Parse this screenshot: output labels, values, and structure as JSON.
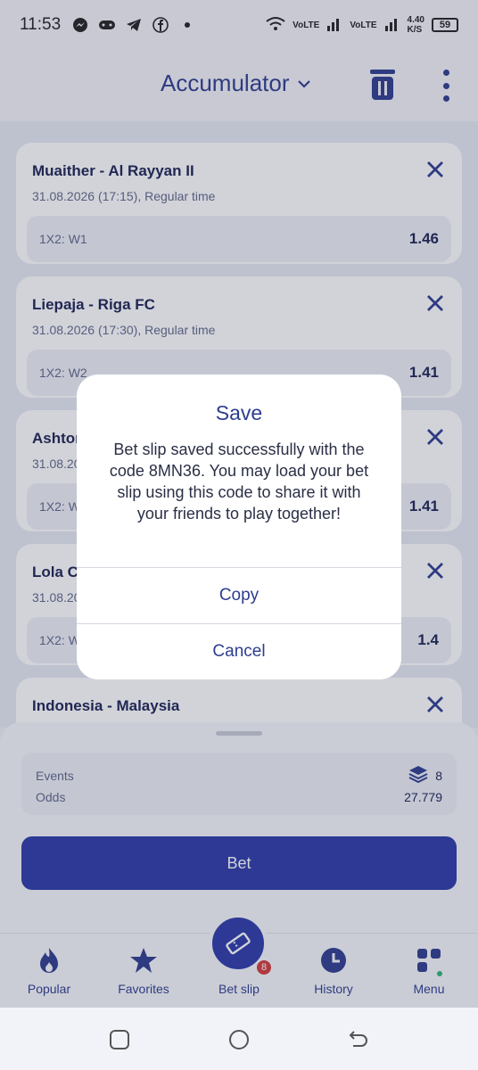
{
  "status_bar": {
    "time": "11:53",
    "network_speed": "4.40",
    "network_unit": "K/S",
    "battery": "59"
  },
  "header": {
    "title": "Accumulator"
  },
  "bets": [
    {
      "match": "Muaither - Al Rayyan II",
      "datetime": "31.08.2026 (17:15), Regular time",
      "market": "1X2: W1",
      "odd": "1.46"
    },
    {
      "match": "Liepaja - Riga FC",
      "datetime": "31.08.2026 (17:30), Regular time",
      "market": "1X2: W2",
      "odd": "1.41"
    },
    {
      "match": "Ashtor",
      "datetime": "31.08.20",
      "market": "1X2: W",
      "odd": "1.41"
    },
    {
      "match": "Lola C",
      "datetime": "31.08.20",
      "market": "1X2: W",
      "odd": "1.4"
    },
    {
      "match": "Indonesia - Malaysia",
      "datetime": "",
      "market": "",
      "odd": ""
    }
  ],
  "summary": {
    "events_label": "Events",
    "events_value": "8",
    "odds_label": "Odds",
    "odds_value": "27.779"
  },
  "bet_button": "Bet",
  "nav": {
    "popular": "Popular",
    "favorites": "Favorites",
    "betslip": "Bet slip",
    "betslip_badge": "8",
    "history": "History",
    "menu": "Menu"
  },
  "dialog": {
    "title": "Save",
    "message": "Bet slip saved successfully with the code 8MN36. You may load your bet slip using this code to share it with your friends to play together!",
    "copy": "Copy",
    "cancel": "Cancel"
  },
  "colors": {
    "primary": "#2c3aa8",
    "accent_text": "#2d3d8f",
    "badge": "#d33b3b",
    "online_dot": "#2bb673"
  }
}
